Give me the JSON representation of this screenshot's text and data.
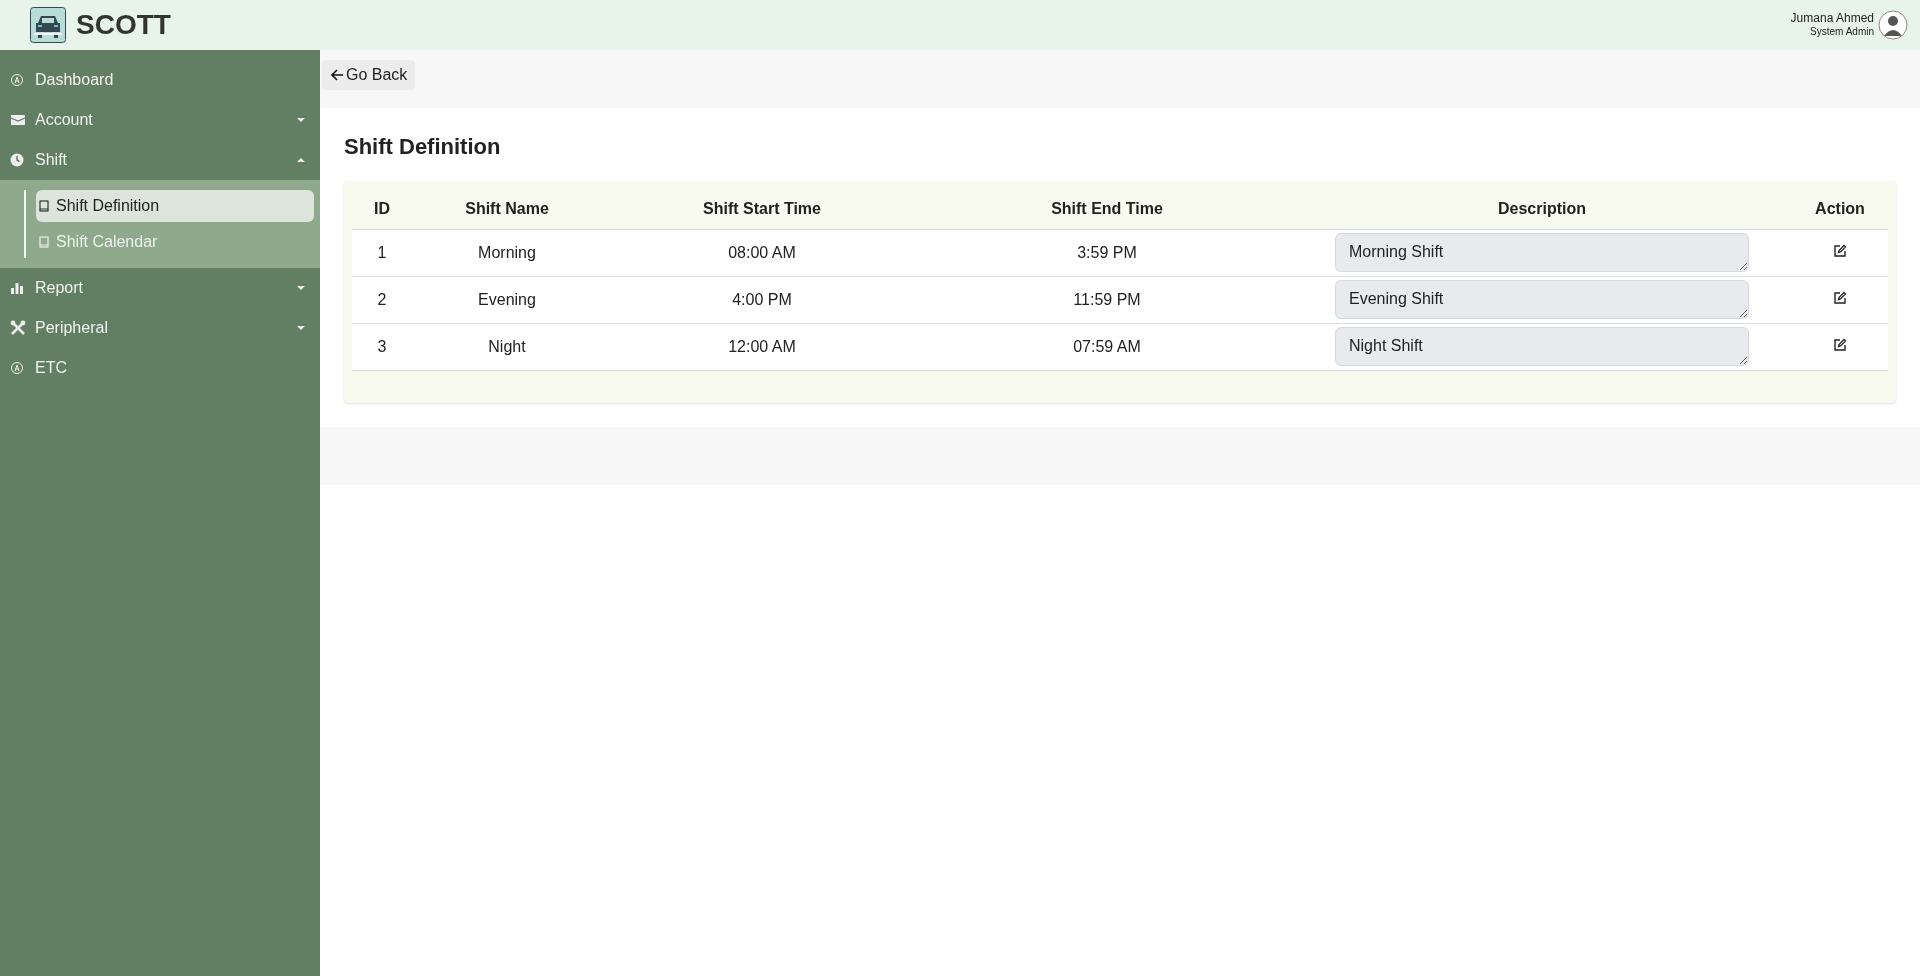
{
  "header": {
    "brand": "SCOTT",
    "user": {
      "name": "Jumana Ahmed",
      "role": "System Admin"
    }
  },
  "sidebar": {
    "items": [
      {
        "label": "Dashboard"
      },
      {
        "label": "Account",
        "expanded": false
      },
      {
        "label": "Shift",
        "expanded": true,
        "children": [
          {
            "label": "Shift Definition",
            "selected": true
          },
          {
            "label": "Shift Calendar",
            "selected": false
          }
        ]
      },
      {
        "label": "Report",
        "expanded": false
      },
      {
        "label": "Peripheral",
        "expanded": false
      },
      {
        "label": "ETC"
      }
    ]
  },
  "back_button": "Go Back",
  "page_title": "Shift Definition",
  "table": {
    "columns": [
      "ID",
      "Shift Name",
      "Shift Start Time",
      "Shift End Time",
      "Description",
      "Action"
    ],
    "rows": [
      {
        "id": "1",
        "name": "Morning",
        "start": "08:00 AM",
        "end": "3:59 PM",
        "description": "Morning Shift"
      },
      {
        "id": "2",
        "name": "Evening",
        "start": "4:00 PM",
        "end": "11:59 PM",
        "description": "Evening Shift"
      },
      {
        "id": "3",
        "name": "Night",
        "start": "12:00 AM",
        "end": "07:59 AM",
        "description": "Night Shift"
      }
    ]
  }
}
